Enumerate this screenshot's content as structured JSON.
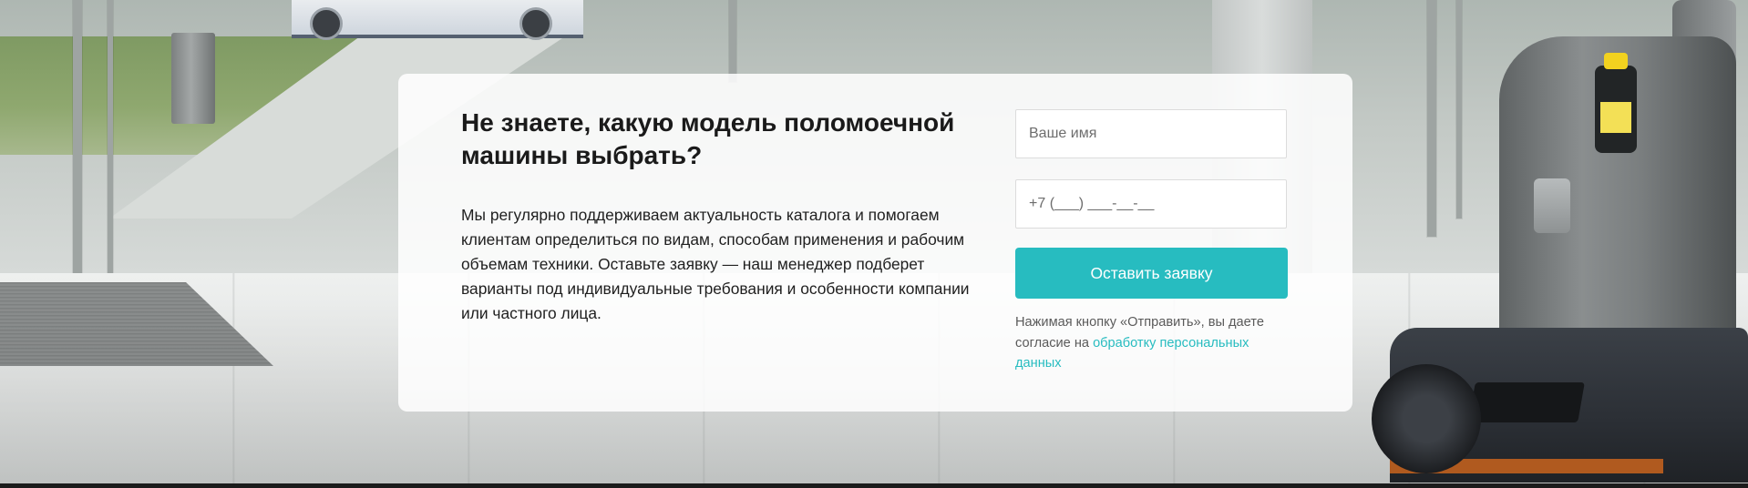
{
  "form_section": {
    "title": "Не знаете, какую модель поломоечной машины выбрать?",
    "description": "Мы регулярно поддерживаем актуальность каталога и помогаем клиентам определиться по видам, способам применения и рабочим объемам техники. Оставьте заявку — наш менеджер подберет варианты под индивидуальные требования и особенности компании или частного лица.",
    "name_field": {
      "placeholder": "Ваше имя",
      "value": ""
    },
    "phone_field": {
      "placeholder": "+7 (___) ___-__-__",
      "value": ""
    },
    "submit_label": "Оставить заявку",
    "consent_text": "Нажимая кнопку «Отправить», вы даете согласие на ",
    "consent_link": "обработку персональных данных"
  },
  "colors": {
    "accent": "#27bcc0",
    "card_background": "#ffffff",
    "text": "#1a1a1a"
  }
}
